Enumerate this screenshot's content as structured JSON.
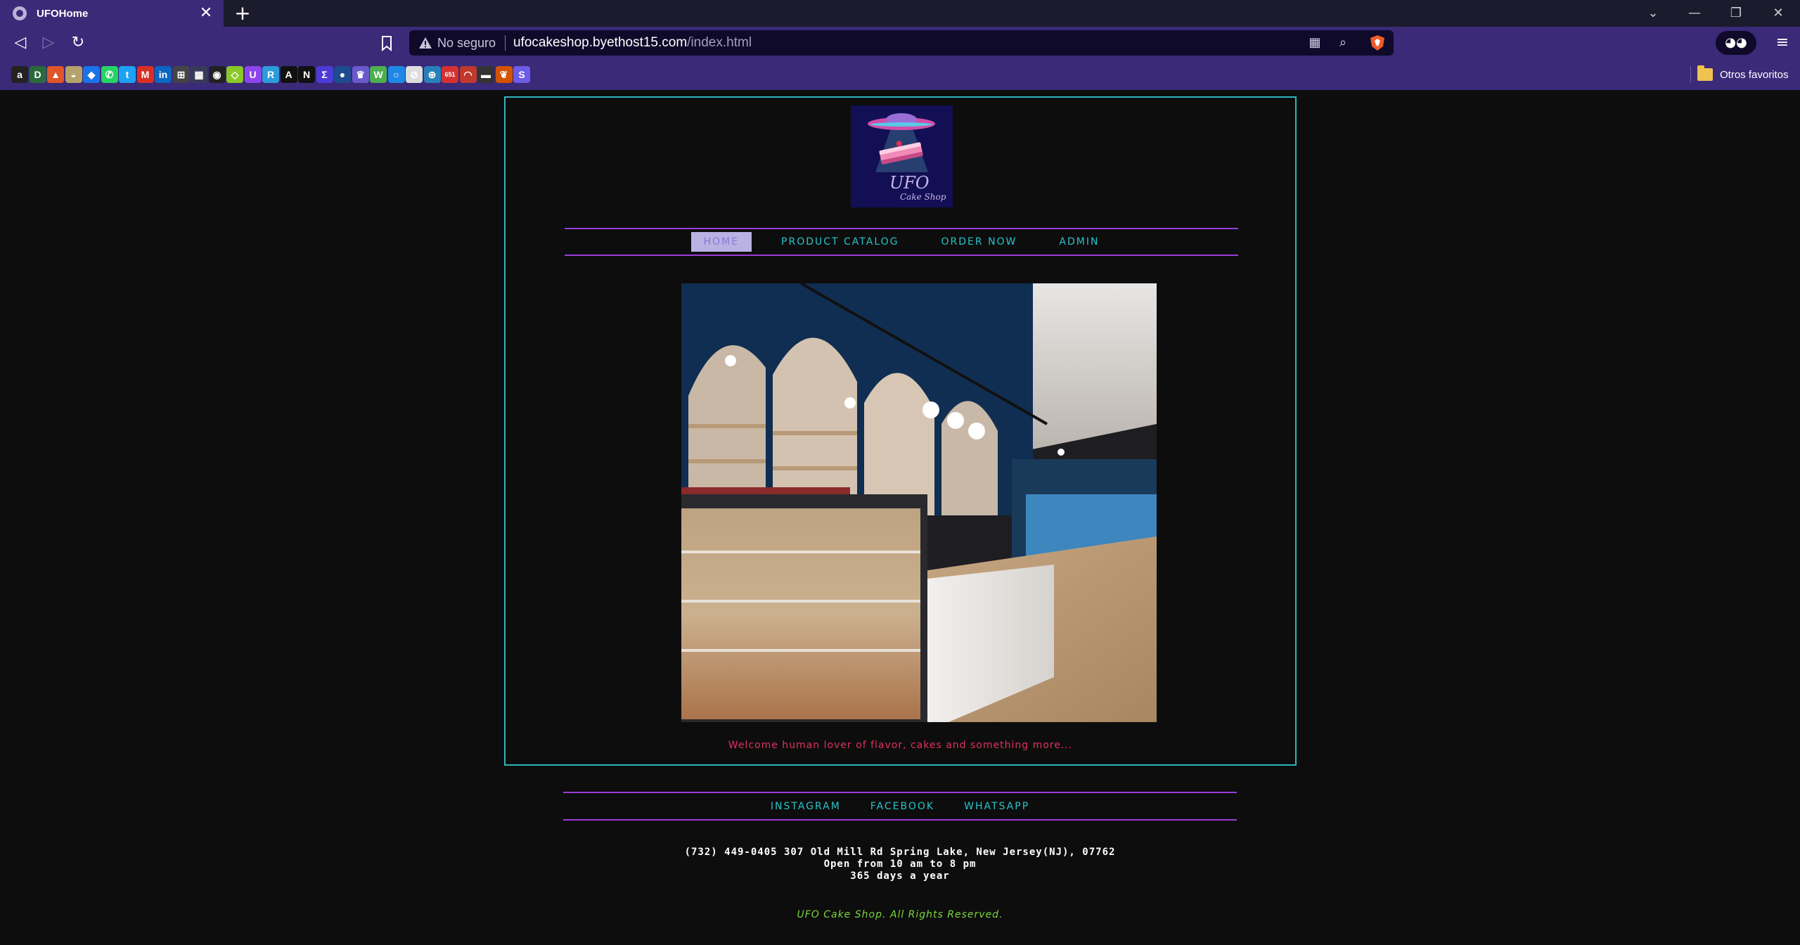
{
  "browser": {
    "tab_title": "UFOHome",
    "tab_close": "✕",
    "new_tab": "+",
    "win_controls": {
      "tabsearch": "⌄",
      "minimize": "—",
      "restore": "❐",
      "close": "✕"
    },
    "url_warning": "No seguro",
    "url_host": "ufocakeshop.byethost15.com",
    "url_path": "/index.html",
    "bookmarks": [
      {
        "icon": "amazon-icon",
        "glyph": "a",
        "color": "#222222"
      },
      {
        "icon": "bookmark-2-icon",
        "glyph": "D",
        "color": "#2b6a3b"
      },
      {
        "icon": "bookmark-3-icon",
        "glyph": "▲",
        "color": "#e0552a"
      },
      {
        "icon": "bookmark-4-icon",
        "glyph": "◒",
        "color": "#b5a26b"
      },
      {
        "icon": "maps-icon",
        "glyph": "◆",
        "color": "#1a73e8"
      },
      {
        "icon": "whatsapp-icon",
        "glyph": "✆",
        "color": "#25d366"
      },
      {
        "icon": "twitter-icon",
        "glyph": "t",
        "color": "#1da1f2"
      },
      {
        "icon": "gmail-icon",
        "glyph": "M",
        "color": "#d93025"
      },
      {
        "icon": "linkedin-icon",
        "glyph": "in",
        "color": "#0a66c2"
      },
      {
        "icon": "bookmark-10-icon",
        "glyph": "⊞",
        "color": "#444444"
      },
      {
        "icon": "bookmark-11-icon",
        "glyph": "▦",
        "color": "#3a3a5a"
      },
      {
        "icon": "github-icon",
        "glyph": "◉",
        "color": "#222222"
      },
      {
        "icon": "bookmark-13-icon",
        "glyph": "◇",
        "color": "#8ac926"
      },
      {
        "icon": "bookmark-14-icon",
        "glyph": "U",
        "color": "#8e44ec"
      },
      {
        "icon": "bookmark-15-icon",
        "glyph": "R",
        "color": "#2d9cdb"
      },
      {
        "icon": "bookmark-16-icon",
        "glyph": "A",
        "color": "#111111"
      },
      {
        "icon": "notion-icon",
        "glyph": "N",
        "color": "#111111"
      },
      {
        "icon": "bookmark-18-icon",
        "glyph": "Σ",
        "color": "#4c3bd6"
      },
      {
        "icon": "bookmark-19-icon",
        "glyph": "●",
        "color": "#1e4b8f"
      },
      {
        "icon": "bookmark-20-icon",
        "glyph": "♛",
        "color": "#6a5acd"
      },
      {
        "icon": "bookmark-21-icon",
        "glyph": "W",
        "color": "#4caf50"
      },
      {
        "icon": "bookmark-22-icon",
        "glyph": "○",
        "color": "#1e88e5"
      },
      {
        "icon": "bookmark-23-icon",
        "glyph": "⊘",
        "color": "#dddddd"
      },
      {
        "icon": "bookmark-24-icon",
        "glyph": "⊕",
        "color": "#2980b9"
      },
      {
        "icon": "bookmark-25-icon",
        "glyph": "651",
        "color": "#d63031"
      },
      {
        "icon": "bookmark-26-icon",
        "glyph": "◠",
        "color": "#c0392b"
      },
      {
        "icon": "bookmark-27-icon",
        "glyph": "▬",
        "color": "#333333"
      },
      {
        "icon": "bookmark-28-icon",
        "glyph": "❦",
        "color": "#d35400"
      },
      {
        "icon": "bookmark-29-icon",
        "glyph": "S",
        "color": "#6c5ce7"
      }
    ],
    "bookmarks_folder": "Otros favoritos"
  },
  "page": {
    "nav": [
      "HOME",
      "PRODUCT CATALOG",
      "ORDER NOW",
      "ADMIN"
    ],
    "active_nav": "HOME",
    "welcome": "Welcome human lover of flavor, cakes and something more...",
    "logo_text": "UFO",
    "logo_subtext": "Cake Shop",
    "footer_links": [
      "INSTAGRAM",
      "FACEBOOK",
      "WHATSAPP"
    ],
    "address_line1": "(732) 449-0405 307 Old Mill Rd Spring Lake, New Jersey(NJ), 07762",
    "address_line2": "Open from 10 am to 8 pm",
    "address_line3": "365 days a year",
    "copyright": "UFO Cake Shop. All Rights Reserved."
  },
  "colors": {
    "accent_cyan": "#29c4c9",
    "accent_purple": "#9b3cd8",
    "welcome_pink": "#e0315f",
    "copyright_green": "#7cd63a",
    "chrome_purple": "#3a2a78"
  }
}
